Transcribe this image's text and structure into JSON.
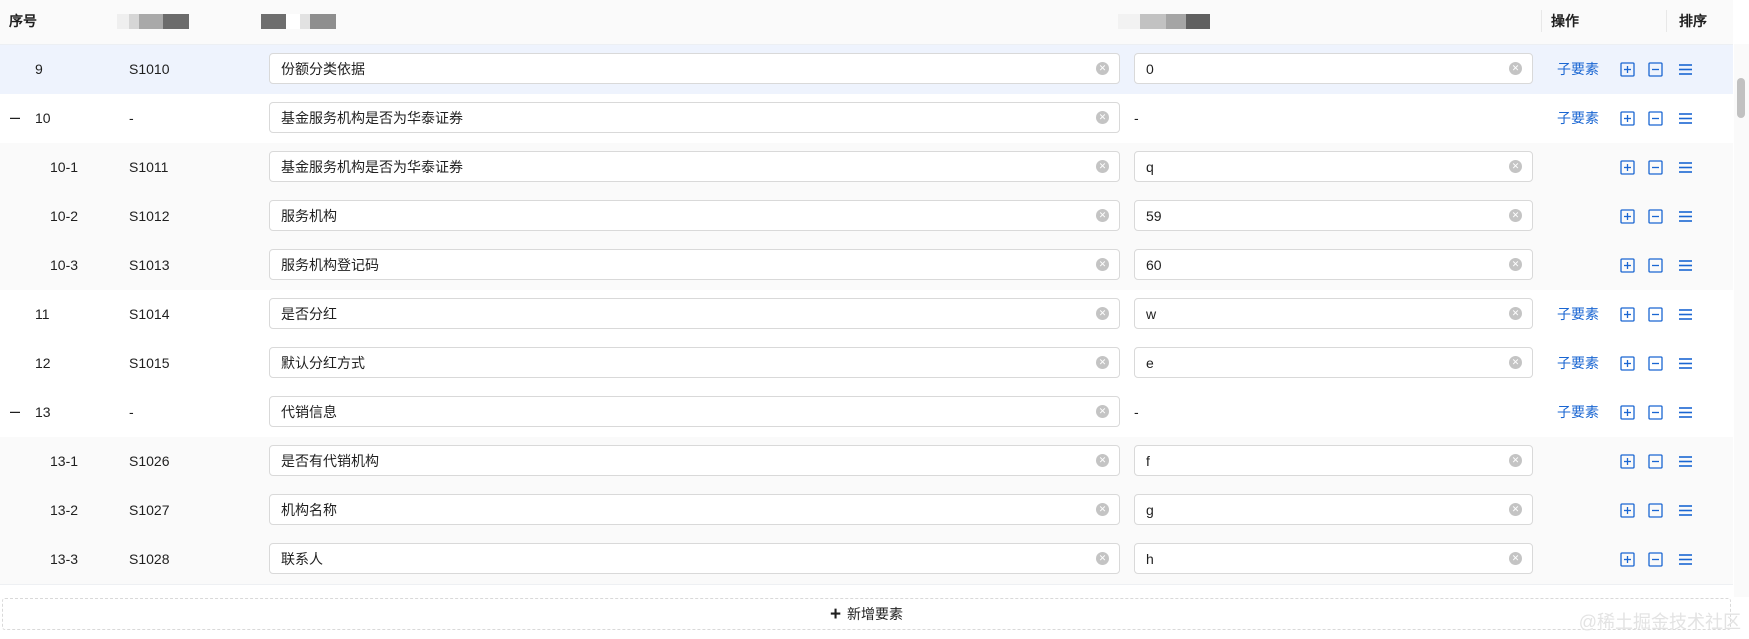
{
  "header": {
    "col_index": "序号",
    "col_actions": "操作",
    "col_sort": "排序"
  },
  "rows": [
    {
      "index": "9",
      "code": "S1010",
      "name": "份额分类依据",
      "value": "0",
      "sub": "子要素"
    },
    {
      "index": "10",
      "code": "-",
      "name": "基金服务机构是否为华泰证券",
      "value": "-",
      "sub": "子要素",
      "toggle": "–"
    },
    {
      "index": "10-1",
      "code": "S1011",
      "name": "基金服务机构是否为华泰证券",
      "value": "q"
    },
    {
      "index": "10-2",
      "code": "S1012",
      "name": "服务机构",
      "value": "59"
    },
    {
      "index": "10-3",
      "code": "S1013",
      "name": "服务机构登记码",
      "value": "60"
    },
    {
      "index": "11",
      "code": "S1014",
      "name": "是否分红",
      "value": "w",
      "sub": "子要素"
    },
    {
      "index": "12",
      "code": "S1015",
      "name": "默认分红方式",
      "value": "e",
      "sub": "子要素"
    },
    {
      "index": "13",
      "code": "-",
      "name": "代销信息",
      "value": "-",
      "sub": "子要素",
      "toggle": "–"
    },
    {
      "index": "13-1",
      "code": "S1026",
      "name": "是否有代销机构",
      "value": "f"
    },
    {
      "index": "13-2",
      "code": "S1027",
      "name": "机构名称",
      "value": "g"
    },
    {
      "index": "13-3",
      "code": "S1028",
      "name": "联系人",
      "value": "h"
    }
  ],
  "add_button": {
    "icon": "plus-icon",
    "label": "新增要素"
  },
  "watermark": "@稀土掘金技术社区",
  "colors": {
    "link": "#1a66d2",
    "selected_row": "#eef3fd",
    "child_row": "#fafafa",
    "header_bg": "#fafafa",
    "icon_blue": "#1a66d2"
  },
  "icons": [
    "clear-icon",
    "plus-square-icon",
    "minus-square-icon",
    "drag-handle-icon",
    "collapse-icon",
    "plus-icon"
  ]
}
